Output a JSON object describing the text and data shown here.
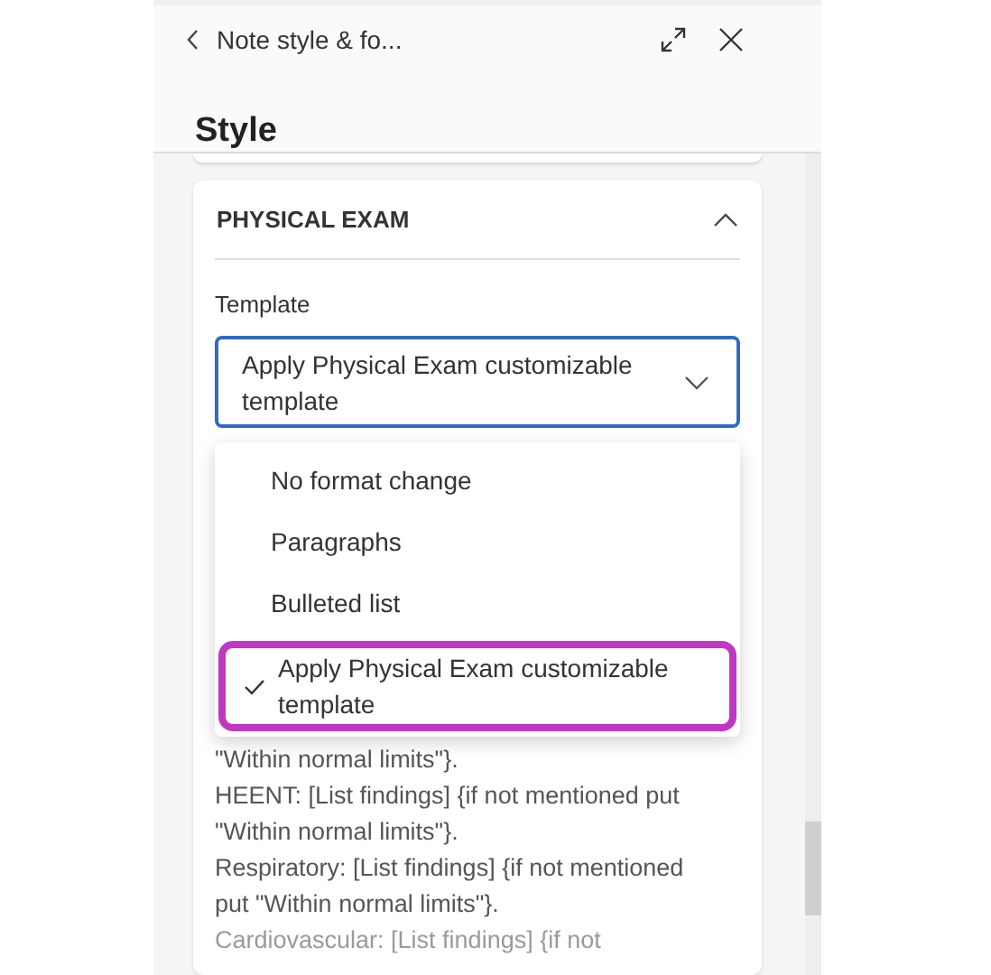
{
  "header": {
    "back_label": "Note style & fo...",
    "title": "Style"
  },
  "section": {
    "title": "PHYSICAL EXAM",
    "expanded": true,
    "template": {
      "label": "Template",
      "value_lines": [
        "Apply Physical Exam customizable",
        "template"
      ],
      "open": true,
      "options": [
        {
          "lines": [
            "No format change"
          ],
          "selected": false,
          "highlighted": false
        },
        {
          "lines": [
            "Paragraphs"
          ],
          "selected": false,
          "highlighted": false
        },
        {
          "lines": [
            "Bulleted list"
          ],
          "selected": false,
          "highlighted": false
        },
        {
          "lines": [
            "Apply Physical Exam customizable",
            "template"
          ],
          "selected": true,
          "highlighted": true
        }
      ]
    },
    "template_text_lines": [
      {
        "text": "\"Within normal limits\"}.",
        "faded": false
      },
      {
        "text": "HEENT: [List findings] {if not mentioned put",
        "faded": false
      },
      {
        "text": "\"Within normal limits\"}.",
        "faded": false
      },
      {
        "text": "Respiratory: [List findings] {if not mentioned",
        "faded": false
      },
      {
        "text": "put \"Within normal limits\"}.",
        "faded": false
      },
      {
        "text": "Cardiovascular: [List findings] {if not",
        "faded": true
      }
    ]
  }
}
